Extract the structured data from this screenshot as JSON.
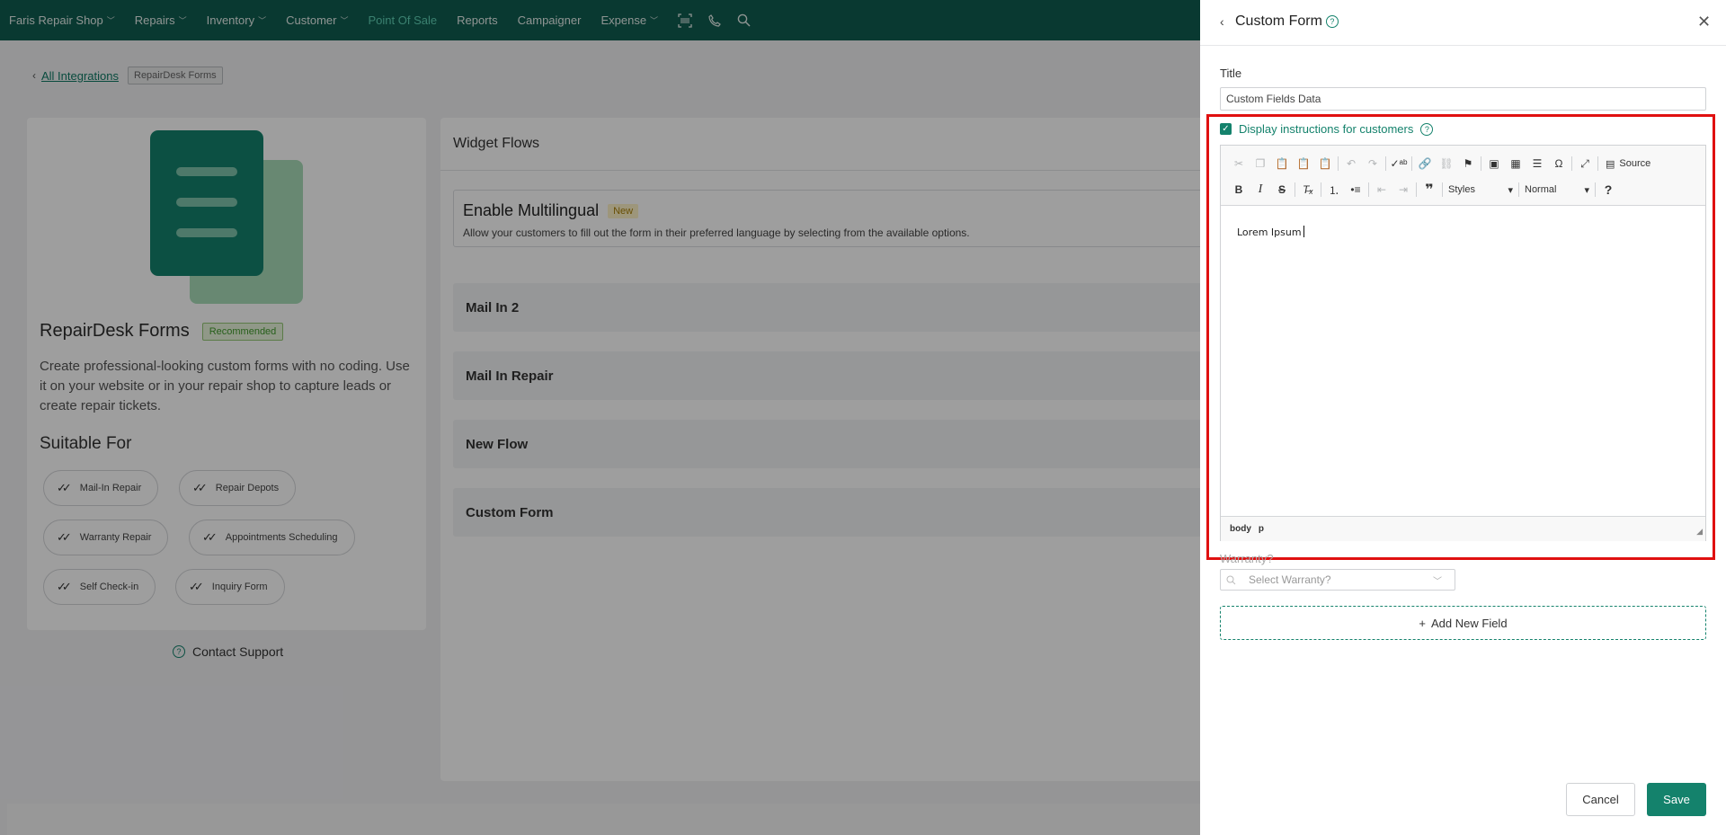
{
  "nav": {
    "items": [
      {
        "label": "Faris Repair Shop",
        "dropdown": true
      },
      {
        "label": "Repairs",
        "dropdown": true
      },
      {
        "label": "Inventory",
        "dropdown": true
      },
      {
        "label": "Customer",
        "dropdown": true
      },
      {
        "label": "Point Of Sale",
        "dropdown": false,
        "active": true
      },
      {
        "label": "Reports",
        "dropdown": false
      },
      {
        "label": "Campaigner",
        "dropdown": false
      },
      {
        "label": "Expense",
        "dropdown": true
      }
    ],
    "icons": [
      "barcode-scan-icon",
      "phone-icon",
      "search-icon"
    ]
  },
  "breadcrumb": {
    "link": "All Integrations",
    "current": "RepairDesk Forms"
  },
  "app": {
    "title": "RepairDesk Forms",
    "badge": "Recommended",
    "description": "Create professional-looking custom forms with no coding. Use it on your website or in your repair shop to capture leads or create repair tickets.",
    "suitable_title": "Suitable For",
    "suitable": [
      "Mail-In Repair",
      "Repair Depots",
      "Warranty Repair",
      "Appointments Scheduling",
      "Self Check-in",
      "Inquiry Form"
    ],
    "contact": "Contact Support"
  },
  "widget_flows": {
    "header": "Widget Flows",
    "multilingual": {
      "title": "Enable Multilingual",
      "badge": "New",
      "description": "Allow your customers to fill out the form in their preferred language by selecting from the available options."
    },
    "flows": [
      "Mail In 2",
      "Mail In Repair",
      "New Flow",
      "Custom Form"
    ]
  },
  "drawer": {
    "title": "Custom Form",
    "title_label": "Title",
    "title_value": "Custom Fields Data",
    "display_instructions": "Display instructions for customers",
    "display_instructions_checked": true,
    "editor": {
      "source_label": "Source",
      "styles_label": "Styles",
      "format_label": "Normal",
      "help_label": "?",
      "content": "Lorem Ipsum",
      "path": [
        "body",
        "p"
      ]
    },
    "warranty_label": "Warranty?",
    "warranty_placeholder": "Select Warranty?",
    "add_field": "Add New Field",
    "cancel": "Cancel",
    "save": "Save"
  },
  "colors": {
    "nav_bg": "#0f5c4f",
    "brand": "#14826c",
    "active_nav": "#5fd0b5",
    "highlight": "#e01010"
  }
}
